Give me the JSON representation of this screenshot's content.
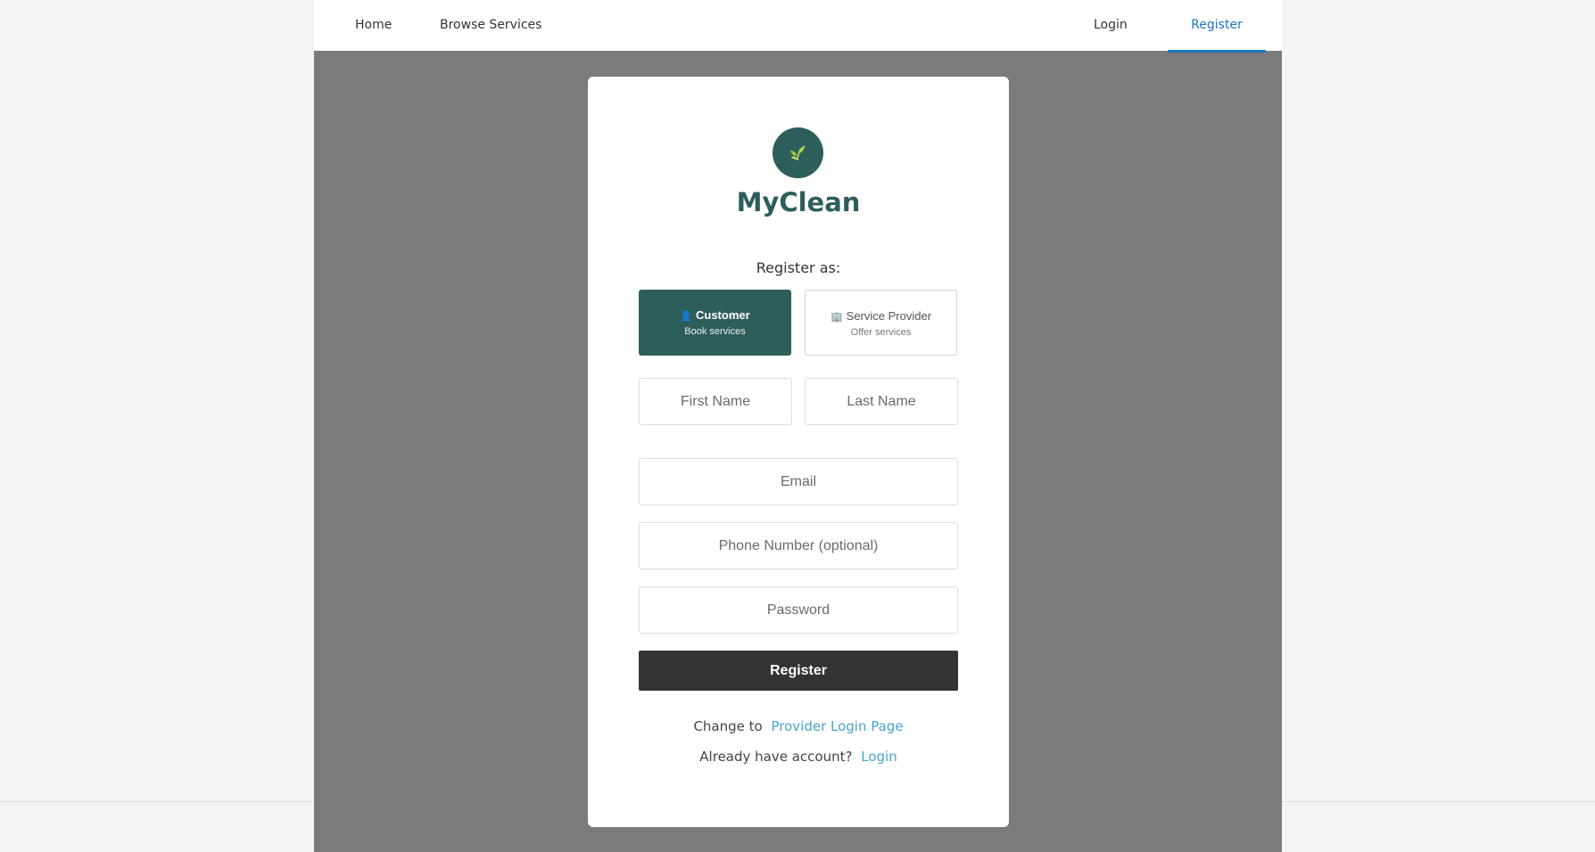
{
  "nav": {
    "home": "Home",
    "browse": "Browse Services",
    "login": "Login",
    "register": "Register"
  },
  "brand": {
    "name": "MyClean",
    "logo_icon": "leaf-icon"
  },
  "form": {
    "register_as_label": "Register as:",
    "roles": [
      {
        "icon": "👤",
        "icon_name": "person-icon",
        "title": "Customer",
        "subtitle": "Book services",
        "selected": true
      },
      {
        "icon": "🏢",
        "icon_name": "building-icon",
        "title": "Service Provider",
        "subtitle": "Offer services",
        "selected": false
      }
    ],
    "first_name_placeholder": "First Name",
    "last_name_placeholder": "Last Name",
    "email_placeholder": "Email",
    "phone_placeholder": "Phone Number (optional)",
    "password_placeholder": "Password",
    "submit_label": "Register",
    "change_text": "Change to",
    "change_link": "Provider Login Page",
    "have_account_text": "Already have account?",
    "have_account_link": "Login"
  },
  "colors": {
    "brand": "#2e5e5c",
    "accent": "#1f74c2",
    "link": "#4aa3cc",
    "button": "#333333",
    "overlay": "#7b7b7b"
  }
}
